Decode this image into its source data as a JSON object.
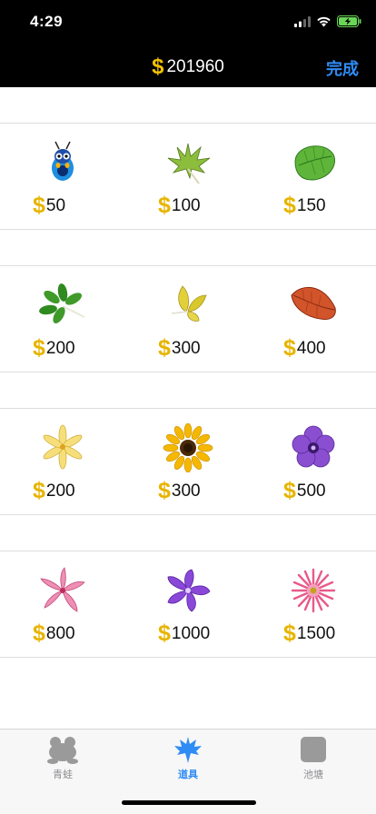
{
  "status": {
    "time": "4:29"
  },
  "header": {
    "currency_symbol": "$",
    "balance": "201960",
    "done_label": "完成"
  },
  "shop": {
    "rows": [
      {
        "items": [
          {
            "icon": "bug-icon",
            "symbol": "$",
            "price": "50"
          },
          {
            "icon": "maple-leaf-icon",
            "symbol": "$",
            "price": "100"
          },
          {
            "icon": "green-leaf-icon",
            "symbol": "$",
            "price": "150"
          }
        ]
      },
      {
        "items": [
          {
            "icon": "clover-leaf-icon",
            "symbol": "$",
            "price": "200"
          },
          {
            "icon": "yellow-leaf-icon",
            "symbol": "$",
            "price": "300"
          },
          {
            "icon": "red-leaf-icon",
            "symbol": "$",
            "price": "400"
          }
        ]
      },
      {
        "items": [
          {
            "icon": "yellow-lily-icon",
            "symbol": "$",
            "price": "200"
          },
          {
            "icon": "sunflower-icon",
            "symbol": "$",
            "price": "300"
          },
          {
            "icon": "purple-flower-icon",
            "symbol": "$",
            "price": "500"
          }
        ]
      },
      {
        "items": [
          {
            "icon": "pink-lily-icon",
            "symbol": "$",
            "price": "800"
          },
          {
            "icon": "periwinkle-flower-icon",
            "symbol": "$",
            "price": "1000"
          },
          {
            "icon": "pink-daisy-icon",
            "symbol": "$",
            "price": "1500"
          }
        ]
      }
    ]
  },
  "tabs": [
    {
      "label": "青蛙",
      "icon": "frog-icon",
      "active": false
    },
    {
      "label": "道具",
      "icon": "maple-leaf-tab-icon",
      "active": true
    },
    {
      "label": "池塘",
      "icon": "pond-square-icon",
      "active": false
    }
  ],
  "colors": {
    "accent": "#2f8cf5",
    "dollar": "#e7b400",
    "header_bg": "#000000",
    "tab_inactive": "#8e8e93"
  }
}
